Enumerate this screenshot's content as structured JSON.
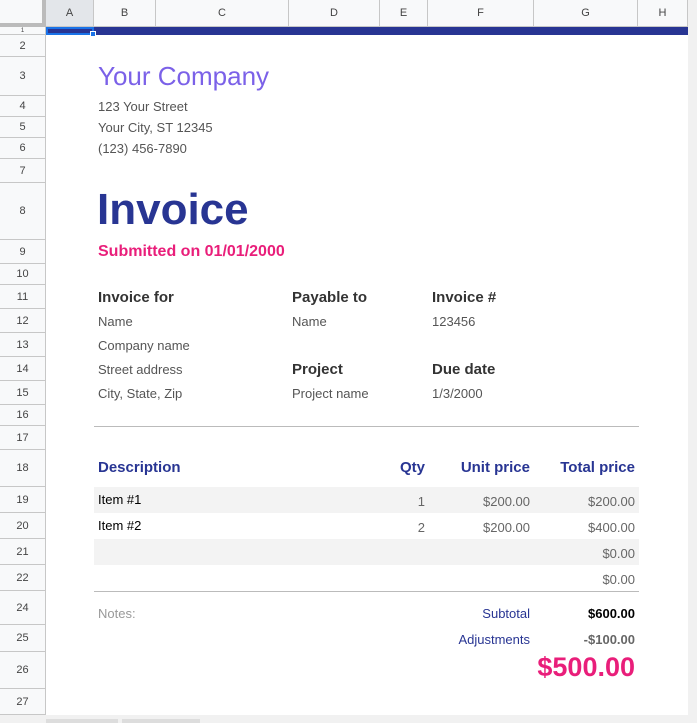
{
  "columns": [
    "A",
    "B",
    "C",
    "D",
    "E",
    "F",
    "G",
    "H"
  ],
  "rows": [
    "1",
    "2",
    "3",
    "4",
    "5",
    "6",
    "7",
    "8",
    "9",
    "10",
    "11",
    "12",
    "13",
    "14",
    "15",
    "16",
    "17",
    "18",
    "19",
    "20",
    "21",
    "22",
    "24",
    "25",
    "26",
    "27"
  ],
  "company": {
    "name": "Your Company",
    "street": "123 Your Street",
    "city": "Your City, ST 12345",
    "phone": "(123) 456-7890"
  },
  "title": "Invoice",
  "submitted": "Submitted on 01/01/2000",
  "invoice_for": {
    "label": "Invoice for",
    "name": "Name",
    "company": "Company name",
    "street": "Street address",
    "city": "City, State, Zip"
  },
  "payable_to": {
    "label": "Payable to",
    "name": "Name"
  },
  "invoice_no": {
    "label": "Invoice #",
    "value": "123456"
  },
  "project": {
    "label": "Project",
    "value": "Project name"
  },
  "due_date": {
    "label": "Due date",
    "value": "1/3/2000"
  },
  "table": {
    "headers": [
      "Description",
      "Qty",
      "Unit price",
      "Total price"
    ],
    "items": [
      {
        "desc": "Item #1",
        "qty": "1",
        "unit": "$200.00",
        "total": "$200.00"
      },
      {
        "desc": "Item #2",
        "qty": "2",
        "unit": "$200.00",
        "total": "$400.00"
      },
      {
        "desc": "",
        "qty": "",
        "unit": "",
        "total": "$0.00"
      },
      {
        "desc": "",
        "qty": "",
        "unit": "",
        "total": "$0.00"
      }
    ]
  },
  "notes_label": "Notes:",
  "subtotal": {
    "label": "Subtotal",
    "value": "$600.00"
  },
  "adjustments": {
    "label": "Adjustments",
    "value": "-$100.00"
  },
  "grand_total": "$500.00",
  "colors": {
    "navy": "#283593",
    "pink": "#e91e7a",
    "purple": "#7b61e8"
  }
}
